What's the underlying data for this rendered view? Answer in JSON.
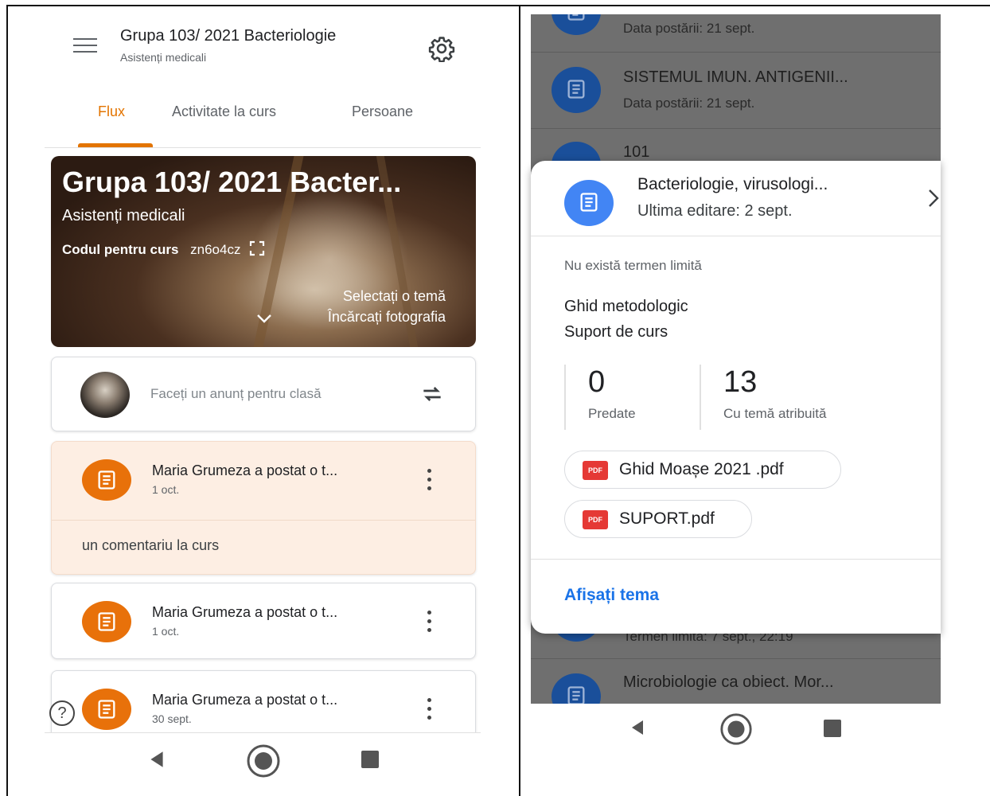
{
  "left": {
    "header": {
      "title": "Grupa 103/ 2021 Bacteriologie",
      "subtitle": "Asistenți medicali"
    },
    "tabs": [
      {
        "label": "Flux",
        "active": true
      },
      {
        "label": "Activitate la curs",
        "active": false
      },
      {
        "label": "Persoane",
        "active": false
      }
    ],
    "banner": {
      "title": "Grupa 103/ 2021 Bacter...",
      "subtitle": "Asistenți medicali",
      "code_label": "Codul pentru curs",
      "code_value": "zn6o4cz",
      "select_theme": "Selectați o temă",
      "upload_photo": "Încărcați fotografia"
    },
    "announce": {
      "placeholder": "Faceți un anunț pentru clasă"
    },
    "posts": [
      {
        "author": "Maria Grumeza a postat o t...",
        "date": "1 oct.",
        "comment": "un comentariu la curs"
      },
      {
        "author": "Maria Grumeza a postat o t...",
        "date": "1 oct."
      },
      {
        "author": "Maria Grumeza a postat o t...",
        "date": "30 sept."
      }
    ],
    "help": "?"
  },
  "right": {
    "background_rows": [
      {
        "title": "",
        "date": "Data postării: 21 sept."
      },
      {
        "title": "SISTEMUL IMUN.  ANTIGENII...",
        "date": "Data postării: 21 sept."
      },
      {
        "title": "101",
        "date": ""
      },
      {
        "title": "",
        "date": "Termen limită: 7 sept., 22:19"
      },
      {
        "title": "Microbiologie ca obiect. Mor...",
        "date": ""
      }
    ],
    "sheet": {
      "title": "Bacteriologie, virusologi...",
      "edited": "Ultima editare: 2 sept.",
      "deadline": "Nu există termen limită",
      "description_line1": "Ghid metodologic",
      "description_line2": "Suport de curs",
      "stats": [
        {
          "value": "0",
          "label": "Predate"
        },
        {
          "value": "13",
          "label": "Cu temă atribuită"
        }
      ],
      "attachments": [
        {
          "name": "Ghid Moașe 2021 .pdf",
          "badge": "PDF"
        },
        {
          "name": "SUPORT.pdf",
          "badge": "PDF"
        }
      ],
      "link": "Afișați tema"
    }
  },
  "colors": {
    "accent_orange": "#e37400",
    "post_icon_orange": "#e8710a",
    "assignment_blue": "#4285f4",
    "link_blue": "#1a73e8",
    "pdf_red": "#e53935"
  }
}
